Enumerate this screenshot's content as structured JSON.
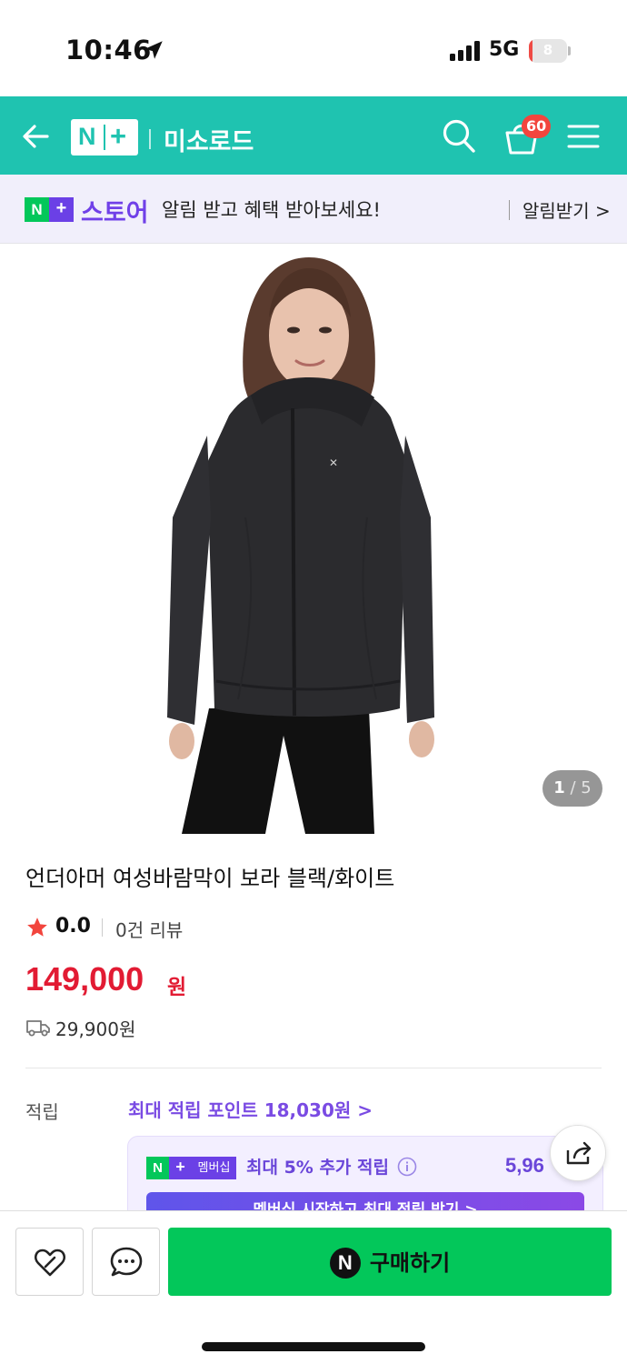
{
  "status_bar": {
    "time": "10:46",
    "network": "5G",
    "battery_level": "8",
    "battery_percent": 8,
    "colors": {
      "battery_low": "#ef4b45"
    }
  },
  "header": {
    "logo": "N+",
    "store_name": "미소로드",
    "cart_count": "60",
    "icons": [
      "back-arrow-icon",
      "search-icon",
      "cart-icon",
      "hamburger-menu-icon"
    ],
    "colors": {
      "background": "#1fc3b0"
    }
  },
  "notice": {
    "store_label": "스토어",
    "message": "알림 받고 혜택 받아보세요!",
    "action_label": "알림받기 >"
  },
  "gallery": {
    "current": "1",
    "separator": " / ",
    "total": "5"
  },
  "product": {
    "title": "언더아머 여성바람막이 보라 블랙/화이트",
    "rating": "0.0",
    "review_count": "0건 리뷰",
    "price": "149,000",
    "price_unit": "원",
    "shipping_fee": "29,900원",
    "colors": {
      "price": "#e21b33",
      "star": "#f2453d"
    }
  },
  "points": {
    "label": "적립",
    "max_points_link": "최대 적립 포인트 18,030원 >",
    "membership_badge": "멤버십",
    "membership_text": "최대 5% 추가 적립",
    "membership_amount": "5,96",
    "membership_cta": "멤버십 시작하고 최대 적립 받기 >",
    "colors": {
      "accent": "#7a4be3"
    }
  },
  "bottom_bar": {
    "buy_label": "구매하기",
    "npay_letter": "N",
    "colors": {
      "buy": "#03c75a"
    }
  }
}
